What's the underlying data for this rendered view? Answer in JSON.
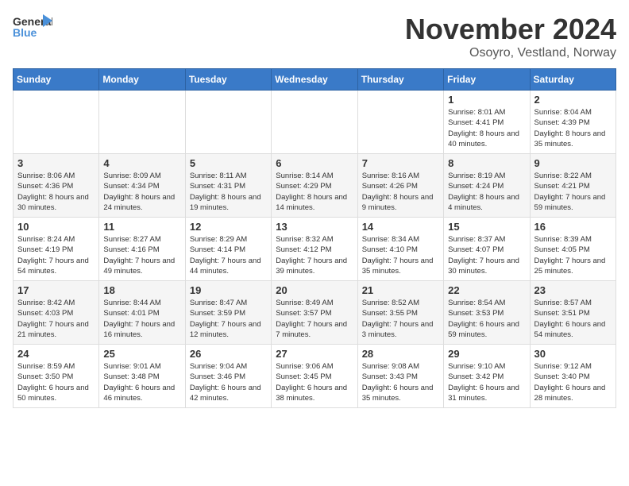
{
  "logo": {
    "line1": "General",
    "line2": "Blue"
  },
  "title": "November 2024",
  "location": "Osoyro, Vestland, Norway",
  "weekdays": [
    "Sunday",
    "Monday",
    "Tuesday",
    "Wednesday",
    "Thursday",
    "Friday",
    "Saturday"
  ],
  "weeks": [
    [
      {
        "day": "",
        "info": ""
      },
      {
        "day": "",
        "info": ""
      },
      {
        "day": "",
        "info": ""
      },
      {
        "day": "",
        "info": ""
      },
      {
        "day": "",
        "info": ""
      },
      {
        "day": "1",
        "info": "Sunrise: 8:01 AM\nSunset: 4:41 PM\nDaylight: 8 hours and 40 minutes."
      },
      {
        "day": "2",
        "info": "Sunrise: 8:04 AM\nSunset: 4:39 PM\nDaylight: 8 hours and 35 minutes."
      }
    ],
    [
      {
        "day": "3",
        "info": "Sunrise: 8:06 AM\nSunset: 4:36 PM\nDaylight: 8 hours and 30 minutes."
      },
      {
        "day": "4",
        "info": "Sunrise: 8:09 AM\nSunset: 4:34 PM\nDaylight: 8 hours and 24 minutes."
      },
      {
        "day": "5",
        "info": "Sunrise: 8:11 AM\nSunset: 4:31 PM\nDaylight: 8 hours and 19 minutes."
      },
      {
        "day": "6",
        "info": "Sunrise: 8:14 AM\nSunset: 4:29 PM\nDaylight: 8 hours and 14 minutes."
      },
      {
        "day": "7",
        "info": "Sunrise: 8:16 AM\nSunset: 4:26 PM\nDaylight: 8 hours and 9 minutes."
      },
      {
        "day": "8",
        "info": "Sunrise: 8:19 AM\nSunset: 4:24 PM\nDaylight: 8 hours and 4 minutes."
      },
      {
        "day": "9",
        "info": "Sunrise: 8:22 AM\nSunset: 4:21 PM\nDaylight: 7 hours and 59 minutes."
      }
    ],
    [
      {
        "day": "10",
        "info": "Sunrise: 8:24 AM\nSunset: 4:19 PM\nDaylight: 7 hours and 54 minutes."
      },
      {
        "day": "11",
        "info": "Sunrise: 8:27 AM\nSunset: 4:16 PM\nDaylight: 7 hours and 49 minutes."
      },
      {
        "day": "12",
        "info": "Sunrise: 8:29 AM\nSunset: 4:14 PM\nDaylight: 7 hours and 44 minutes."
      },
      {
        "day": "13",
        "info": "Sunrise: 8:32 AM\nSunset: 4:12 PM\nDaylight: 7 hours and 39 minutes."
      },
      {
        "day": "14",
        "info": "Sunrise: 8:34 AM\nSunset: 4:10 PM\nDaylight: 7 hours and 35 minutes."
      },
      {
        "day": "15",
        "info": "Sunrise: 8:37 AM\nSunset: 4:07 PM\nDaylight: 7 hours and 30 minutes."
      },
      {
        "day": "16",
        "info": "Sunrise: 8:39 AM\nSunset: 4:05 PM\nDaylight: 7 hours and 25 minutes."
      }
    ],
    [
      {
        "day": "17",
        "info": "Sunrise: 8:42 AM\nSunset: 4:03 PM\nDaylight: 7 hours and 21 minutes."
      },
      {
        "day": "18",
        "info": "Sunrise: 8:44 AM\nSunset: 4:01 PM\nDaylight: 7 hours and 16 minutes."
      },
      {
        "day": "19",
        "info": "Sunrise: 8:47 AM\nSunset: 3:59 PM\nDaylight: 7 hours and 12 minutes."
      },
      {
        "day": "20",
        "info": "Sunrise: 8:49 AM\nSunset: 3:57 PM\nDaylight: 7 hours and 7 minutes."
      },
      {
        "day": "21",
        "info": "Sunrise: 8:52 AM\nSunset: 3:55 PM\nDaylight: 7 hours and 3 minutes."
      },
      {
        "day": "22",
        "info": "Sunrise: 8:54 AM\nSunset: 3:53 PM\nDaylight: 6 hours and 59 minutes."
      },
      {
        "day": "23",
        "info": "Sunrise: 8:57 AM\nSunset: 3:51 PM\nDaylight: 6 hours and 54 minutes."
      }
    ],
    [
      {
        "day": "24",
        "info": "Sunrise: 8:59 AM\nSunset: 3:50 PM\nDaylight: 6 hours and 50 minutes."
      },
      {
        "day": "25",
        "info": "Sunrise: 9:01 AM\nSunset: 3:48 PM\nDaylight: 6 hours and 46 minutes."
      },
      {
        "day": "26",
        "info": "Sunrise: 9:04 AM\nSunset: 3:46 PM\nDaylight: 6 hours and 42 minutes."
      },
      {
        "day": "27",
        "info": "Sunrise: 9:06 AM\nSunset: 3:45 PM\nDaylight: 6 hours and 38 minutes."
      },
      {
        "day": "28",
        "info": "Sunrise: 9:08 AM\nSunset: 3:43 PM\nDaylight: 6 hours and 35 minutes."
      },
      {
        "day": "29",
        "info": "Sunrise: 9:10 AM\nSunset: 3:42 PM\nDaylight: 6 hours and 31 minutes."
      },
      {
        "day": "30",
        "info": "Sunrise: 9:12 AM\nSunset: 3:40 PM\nDaylight: 6 hours and 28 minutes."
      }
    ]
  ]
}
